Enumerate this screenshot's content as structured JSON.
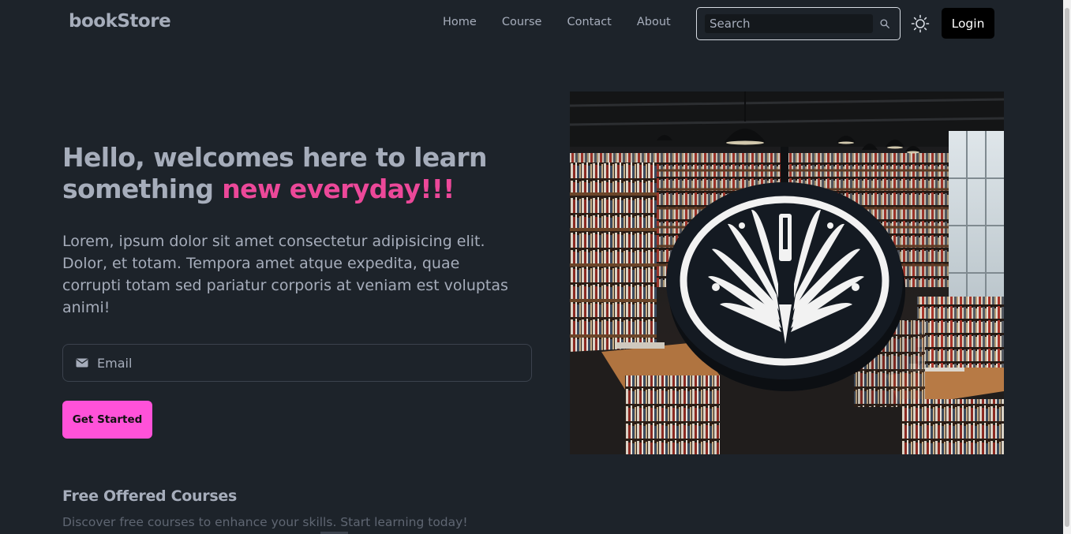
{
  "navbar": {
    "brand": "bookStore",
    "links": [
      {
        "label": "Home"
      },
      {
        "label": "Course"
      },
      {
        "label": "Contact"
      },
      {
        "label": "About"
      }
    ],
    "search_placeholder": "Search",
    "search_icon": "search-icon",
    "theme_icon": "sun-icon",
    "login_label": "Login"
  },
  "hero": {
    "heading_main": "Hello, welcomes here to learn something ",
    "heading_accent": "new everyday!!!",
    "paragraph": "Lorem, ipsum dolor sit amet consectetur adipisicing elit. Dolor, et totam. Tempora amet atque expedita, quae corrupti totam sed pariatur corporis at veniam est voluptas animi!",
    "email_placeholder": "Email",
    "email_icon": "envelope-icon",
    "cta_label": "Get Started",
    "image_alt": "bookstore-illustration"
  },
  "courses": {
    "title": "Free Offered Courses",
    "subtitle": "Discover free courses to enhance your skills. Start learning today!"
  },
  "colors": {
    "background": "#1d232a",
    "text": "#a6adbb",
    "accent_pink": "#ec4899",
    "cta_pink": "#ff52d9",
    "login_bg": "#000000"
  }
}
